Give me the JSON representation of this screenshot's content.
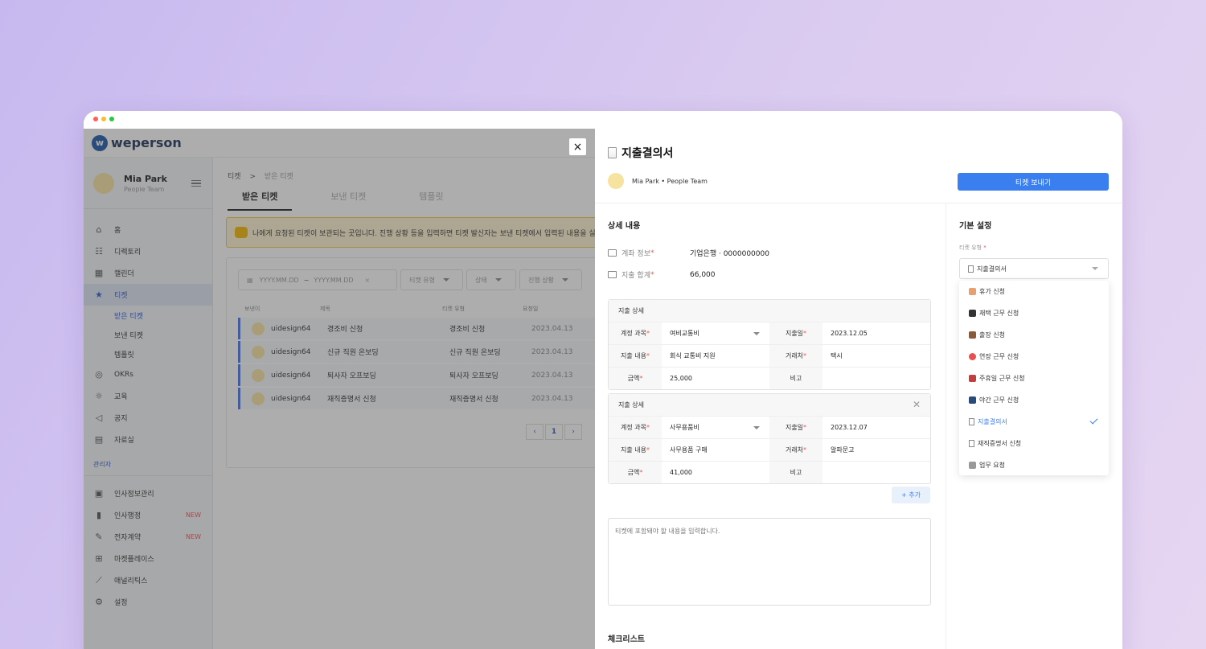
{
  "app": {
    "logo": "weperson"
  },
  "user": {
    "name": "Mia Park",
    "team": "People Team"
  },
  "nav": {
    "items": [
      {
        "label": "홈"
      },
      {
        "label": "디렉토리"
      },
      {
        "label": "캘린더"
      },
      {
        "label": "티켓"
      }
    ],
    "subitems": [
      {
        "label": "받은 티켓"
      },
      {
        "label": "보낸 티켓"
      },
      {
        "label": "템플릿"
      }
    ],
    "items2": [
      {
        "label": "OKRs"
      },
      {
        "label": "교육"
      },
      {
        "label": "공지"
      },
      {
        "label": "자료실"
      }
    ],
    "admin_section": "관리자",
    "admin_items": [
      {
        "label": "인사정보관리",
        "badge": ""
      },
      {
        "label": "인사행정",
        "badge": "NEW"
      },
      {
        "label": "전자계약",
        "badge": "NEW"
      },
      {
        "label": "마켓플레이스",
        "badge": ""
      },
      {
        "label": "애널리틱스",
        "badge": ""
      },
      {
        "label": "설정",
        "badge": ""
      }
    ]
  },
  "main": {
    "breadcrumb": {
      "root": "티켓",
      "sep": ">",
      "current": "받은 티켓"
    },
    "tabs": [
      {
        "label": "받은 티켓"
      },
      {
        "label": "보낸 티켓"
      },
      {
        "label": "템플릿"
      }
    ],
    "notice": "나에게 요청된 티켓이 보관되는 곳입니다. 진행 상황 등을 입력하면 티켓 발신자는 보낸 티켓에서 입력된 내용을 실시",
    "filters": {
      "date_from": "YYYY.MM.DD",
      "date_sep": "~",
      "date_to": "YYYY.MM.DD",
      "date_clear": "×",
      "type": "티켓 유형",
      "status": "상태",
      "progress": "진행 상황"
    },
    "columns": [
      "보낸이",
      "제목",
      "티켓 유형",
      "요청일"
    ],
    "rows": [
      {
        "sender": "uidesign64",
        "title": "경조비 신청",
        "type": "경조비 신청",
        "date": "2023.04.13"
      },
      {
        "sender": "uidesign64",
        "title": "신규 직원 온보딩",
        "type": "신규 직원 온보딩",
        "date": "2023.04.13"
      },
      {
        "sender": "uidesign64",
        "title": "퇴사자 오프보딩",
        "type": "퇴사자 오프보딩",
        "date": "2023.04.13"
      },
      {
        "sender": "uidesign64",
        "title": "재직증명서 신청",
        "type": "재직증명서 신청",
        "date": "2023.04.13"
      }
    ],
    "pager": {
      "prev": "‹",
      "page": "1",
      "next": "›"
    }
  },
  "drawer": {
    "close": "×",
    "title": "지출결의서",
    "author": "Mia Park • People Team",
    "send_button": "티켓 보내기",
    "details_heading": "상세 내용",
    "fields": [
      {
        "label": "계좌 정보",
        "required": "*",
        "value": "기업은행 · 0000000000"
      },
      {
        "label": "지출 합계",
        "required": "*",
        "value": "66,000"
      }
    ],
    "cards": [
      {
        "header": "지출 상세",
        "rows": [
          {
            "l1": "계정 과목",
            "v1": "여비교통비",
            "l2": "지출일",
            "v2": "2023.12.05"
          },
          {
            "l1": "지출 내용",
            "v1": "회식 교통비 지원",
            "l2": "거래처",
            "v2": "택시"
          },
          {
            "l1": "금액",
            "v1": "25,000",
            "l2": "비고",
            "v2": ""
          }
        ]
      },
      {
        "header": "지출 상세",
        "rows": [
          {
            "l1": "계정 과목",
            "v1": "사무용품비",
            "l2": "지출일",
            "v2": "2023.12.07"
          },
          {
            "l1": "지출 내용",
            "v1": "사무용품 구매",
            "l2": "거래처",
            "v2": "알파문고"
          },
          {
            "l1": "금액",
            "v1": "41,000",
            "l2": "비고",
            "v2": ""
          }
        ]
      }
    ],
    "add_button": "+ 추가",
    "memo_placeholder": "티켓에 포함돼야 할 내용을 입력합니다.",
    "checklist_heading": "체크리스트",
    "settings_heading": "기본 설정",
    "ticket_type_label": "티켓 유형",
    "ticket_type_required": "*",
    "ticket_type_value": "지출결의서",
    "options": [
      {
        "label": "휴가 신청",
        "color": "#e8a070"
      },
      {
        "label": "재택 근무 신청",
        "color": "#333333"
      },
      {
        "label": "출장 신청",
        "color": "#8a5a3a"
      },
      {
        "label": "연장 근무 신청",
        "color": "#e85050"
      },
      {
        "label": "주휴일 근무 신청",
        "color": "#c04040"
      },
      {
        "label": "야간 근무 신청",
        "color": "#2a4a7a"
      },
      {
        "label": "지출결의서",
        "color": "#bbbbbb"
      },
      {
        "label": "재직증명서 신청",
        "color": "#bbbbbb"
      },
      {
        "label": "업무 요청",
        "color": "#999999"
      }
    ],
    "selected_option": "지출결의서"
  },
  "colors": {
    "accent": "#3a7ff0",
    "sidebar_active": "#2f5ad6",
    "notice_bg": "#fff3d1",
    "new_badge": "#e55555"
  }
}
